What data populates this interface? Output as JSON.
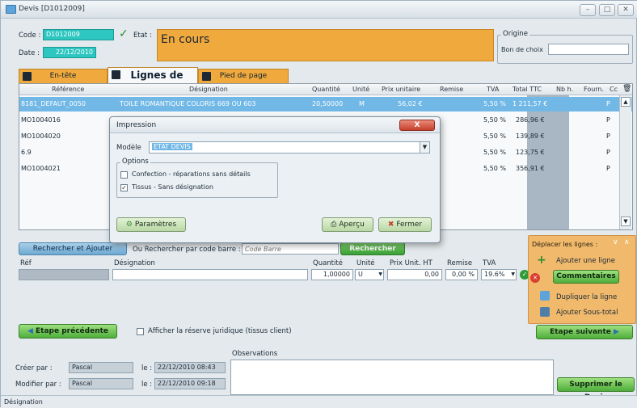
{
  "window": {
    "title": "Devis [D1012009]"
  },
  "header": {
    "code_label": "Code :",
    "code_value": "D1012009",
    "etat_label": "Etat :",
    "etat_value": "En cours",
    "date_label": "Date :",
    "date_value": "22/12/2010",
    "origine_label": "Origine",
    "bon_label": "Bon de choix",
    "bon_value": ""
  },
  "tabs": [
    {
      "label": "En-tête"
    },
    {
      "label": "Lignes de Devis"
    },
    {
      "label": "Pied de page"
    }
  ],
  "grid": {
    "headers": [
      "Référence",
      "Désignation",
      "Quantité",
      "Unité",
      "Prix unitaire",
      "Remise",
      "TVA",
      "Total TTC",
      "Nb h.",
      "Fourn.",
      "Cc"
    ],
    "rows": [
      {
        "ref": "8181_DEFAUT_0050",
        "designation": "TOILE ROMANTIQUE COLORIS 669 OU 603",
        "quantite": "20,50000",
        "unite": "M",
        "prix": "56,02 €",
        "tva": "5,50 %",
        "total": "1 211,57 €",
        "cc": "P"
      },
      {
        "ref": "MO1004016",
        "designation": "",
        "quantite": "",
        "unite": "",
        "prix": "",
        "tva": "5,50 %",
        "total": "286,96 €",
        "cc": "P"
      },
      {
        "ref": "MO1004020",
        "designation": "",
        "quantite": "",
        "unite": "",
        "prix": "",
        "tva": "5,50 %",
        "total": "139,89 €",
        "cc": "P"
      },
      {
        "ref": "6.9",
        "designation": "",
        "quantite": "",
        "unite": "",
        "prix": "",
        "tva": "5,50 %",
        "total": "123,75 €",
        "cc": "P"
      },
      {
        "ref": "MO1004021",
        "designation": "",
        "quantite": "",
        "unite": "",
        "prix": "",
        "tva": "5,50 %",
        "total": "356,91 €",
        "cc": "P"
      }
    ]
  },
  "dialog": {
    "title": "Impression",
    "close_label": "X",
    "modele_label": "Modèle",
    "modele_value": "ETAT DEVIS",
    "options_label": "Options",
    "option1": "Confection - réparations sans détails",
    "option1_checked": false,
    "option2": "Tissus - Sans désignation",
    "option2_checked": true,
    "parametres": "Paramètres",
    "apercu": "Aperçu",
    "fermer": "Fermer"
  },
  "search": {
    "btn_label": "Rechercher et Ajouter",
    "barcode_label": "Ou Rechercher par code barre :",
    "barcode_placeholder": "Code Barre",
    "rechercher": "Rechercher"
  },
  "entry": {
    "ref_label": "Réf",
    "designation_label": "Désignation",
    "quantite_label": "Quantité",
    "unite_label": "Unité",
    "prix_label": "Prix Unit. HT",
    "remise_label": "Remise",
    "tva_label": "TVA",
    "quantite_value": "1,00000",
    "unite_value": "U",
    "prix_value": "0,00",
    "remise_value": "0,00 %",
    "tva_value": "19.6% "
  },
  "side": {
    "deplacer": "Déplacer les lignes :",
    "ajouter_ligne": "Ajouter une ligne",
    "commentaires": "Commentaires",
    "dupliquer": "Dupliquer la ligne",
    "sous_total": "Ajouter Sous-total"
  },
  "nav": {
    "prev": "Etape précédente",
    "next": "Etape suivante",
    "reserve": "Afficher la réserve juridique (tissus client)"
  },
  "footer": {
    "observations": "Observations",
    "creer_label": "Créer par :",
    "creer_value": "Pascal",
    "modifier_label": "Modifier par :",
    "modifier_value": "Pascal",
    "le_label": "le :",
    "creer_date": "22/12/2010 08:43",
    "modifier_date": "22/12/2010 09:18",
    "supprimer": "Supprimer le Devis",
    "status": "Désignation"
  },
  "colors": {
    "accent_orange": "#f0a93d",
    "teal": "#2dc6c0",
    "selection": "#71b8e6",
    "green": "#3a9e36",
    "brand_blue": "#5ca4d9"
  }
}
